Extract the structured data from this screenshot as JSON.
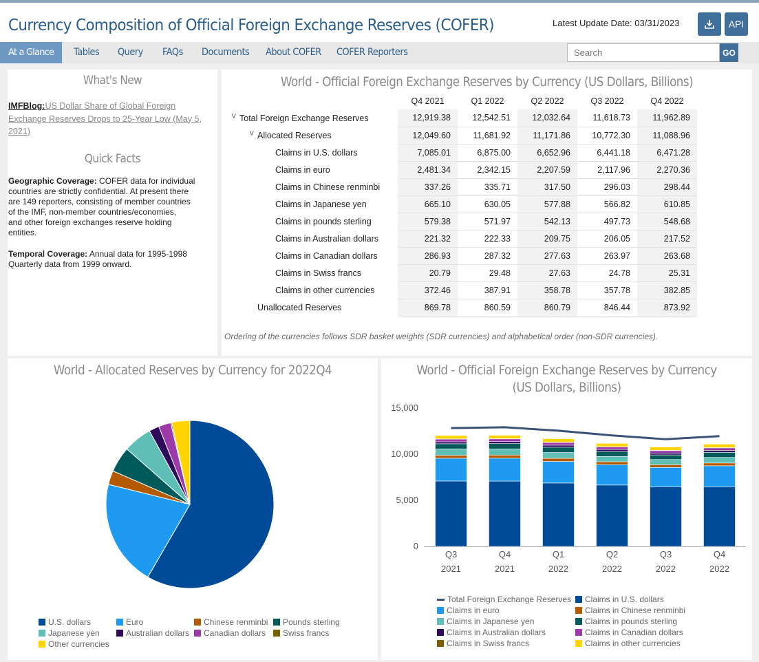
{
  "header": {
    "title": "Currency Composition of Official Foreign Exchange Reserves (COFER)",
    "update_text": "Latest Update Date: 03/31/2023",
    "download_icon": "download-icon",
    "api_label": "API"
  },
  "nav": {
    "items": [
      "At a Glance",
      "Tables",
      "Query",
      "FAQs",
      "Documents",
      "About COFER",
      "COFER Reporters"
    ],
    "search_placeholder": "Search",
    "go_label": "GO"
  },
  "sidebar": {
    "whats_new_title": "What's New",
    "blog_label": "IMFBlog:",
    "blog_lines": [
      "US Dollar Share of Global Foreign",
      "Exchange Reserves Drops to 25-Year Low (May 5,",
      "2021)"
    ],
    "quick_facts_title": "Quick Facts",
    "geo_label": "Geographic Coverage:",
    "geo_lines": [
      " COFER data for individual",
      "countries are strictly confidential. At present there",
      "are 149 reporters, consisting of member countries",
      "of the IMF, non-member countries/economies,",
      "and other foreign exchanges reserve holding",
      "entities."
    ],
    "temporal_label": "Temporal Coverage:",
    "temporal_lines": [
      " Annual data for 1995-1998",
      "Quarterly data from 1999 onward."
    ]
  },
  "table": {
    "title": "World - Official Foreign Exchange Reserves by Currency (US Dollars, Billions)",
    "columns": [
      "Q4 2021",
      "Q1 2022",
      "Q2 2022",
      "Q3 2022",
      "Q4 2022"
    ],
    "rows": [
      {
        "label": "Total Foreign Exchange Reserves",
        "values": [
          "12,919.38",
          "12,542.51",
          "12,032.64",
          "11,618.73",
          "11,962.89"
        ]
      },
      {
        "label": "Allocated Reserves",
        "values": [
          "12,049.60",
          "11,681.92",
          "11,171.86",
          "10,772.30",
          "11,088.96"
        ]
      },
      {
        "label": "Claims in U.S. dollars",
        "values": [
          "7,085.01",
          "6,875.00",
          "6,652.96",
          "6,441.18",
          "6,471.28"
        ]
      },
      {
        "label": "Claims in euro",
        "values": [
          "2,481.34",
          "2,342.15",
          "2,207.59",
          "2,117.96",
          "2,270.36"
        ]
      },
      {
        "label": "Claims in Chinese renminbi",
        "values": [
          "337.26",
          "335.71",
          "317.50",
          "296.03",
          "298.44"
        ]
      },
      {
        "label": "Claims in Japanese yen",
        "values": [
          "665.10",
          "630.05",
          "577.88",
          "566.82",
          "610.85"
        ]
      },
      {
        "label": "Claims in pounds sterling",
        "values": [
          "579.38",
          "571.97",
          "542.13",
          "497.73",
          "548.68"
        ]
      },
      {
        "label": "Claims in Australian dollars",
        "values": [
          "221.32",
          "222.33",
          "209.75",
          "206.05",
          "217.52"
        ]
      },
      {
        "label": "Claims in Canadian dollars",
        "values": [
          "286.93",
          "287.32",
          "277.63",
          "263.97",
          "263.68"
        ]
      },
      {
        "label": "Claims in Swiss francs",
        "values": [
          "20.79",
          "29.48",
          "27.63",
          "24.78",
          "25.31"
        ]
      },
      {
        "label": "Claims in other currencies",
        "values": [
          "372.46",
          "387.91",
          "358.78",
          "357.78",
          "382.85"
        ]
      },
      {
        "label": "Unallocated Reserves",
        "values": [
          "869.78",
          "860.59",
          "860.79",
          "846.44",
          "873.92"
        ]
      }
    ],
    "note": "Ordering of the currencies follows SDR basket weights (SDR currencies) and alphabetical order (non-SDR currencies)."
  },
  "colors": {
    "usd": "#004a97",
    "eur": "#1e9bf0",
    "cny": "#b35a00",
    "gbp": "#005a5a",
    "jpy": "#5fbfb6",
    "aud": "#2e0a5a",
    "cad": "#9b3aa8",
    "chf": "#7a6000",
    "other": "#ffd400",
    "total_line": "#3a5478"
  },
  "chart_data": [
    {
      "type": "pie",
      "title": "World - Allocated Reserves by Currency for 2022Q4",
      "labels": [
        "U.S. dollars",
        "Euro",
        "Chinese renminbi",
        "Pounds sterling",
        "Japanese yen",
        "Australian dollars",
        "Canadian dollars",
        "Swiss francs",
        "Other currencies"
      ],
      "values": [
        6471.28,
        2270.36,
        298.44,
        548.68,
        610.85,
        217.52,
        263.68,
        25.31,
        382.85
      ],
      "legend_position": "bottom"
    },
    {
      "type": "bar",
      "stacked": true,
      "title": "World - Official Foreign Exchange Reserves by Currency",
      "title_line2": "(US Dollars, Billions)",
      "categories": [
        "Q3 2021",
        "Q4 2021",
        "Q1 2022",
        "Q2 2022",
        "Q3 2022",
        "Q4 2022"
      ],
      "category_lines": [
        [
          "Q3",
          "2021"
        ],
        [
          "Q4",
          "2021"
        ],
        [
          "Q1",
          "2022"
        ],
        [
          "Q2",
          "2022"
        ],
        [
          "Q3",
          "2022"
        ],
        [
          "Q4",
          "2022"
        ]
      ],
      "ylim": [
        0,
        15000
      ],
      "yticks": [
        "15,000",
        "10,000",
        "5,000",
        "0"
      ],
      "ytick_values": [
        15000,
        10000,
        5000,
        0
      ],
      "line_series": {
        "name": "Total Foreign Exchange Reserves",
        "values": [
          12830,
          12919.38,
          12542.51,
          12032.64,
          11618.73,
          11962.89
        ]
      },
      "series": [
        {
          "name": "Claims in U.S. dollars",
          "key": "usd",
          "values": [
            7090,
            7085.01,
            6875.0,
            6652.96,
            6441.18,
            6471.28
          ]
        },
        {
          "name": "Claims in euro",
          "key": "eur",
          "values": [
            2470,
            2481.34,
            2342.15,
            2207.59,
            2117.96,
            2270.36
          ]
        },
        {
          "name": "Claims in Chinese renminbi",
          "key": "cny",
          "values": [
            320,
            337.26,
            335.71,
            317.5,
            296.03,
            298.44
          ]
        },
        {
          "name": "Claims in Japanese yen",
          "key": "jpy",
          "values": [
            680,
            665.1,
            630.05,
            577.88,
            566.82,
            610.85
          ]
        },
        {
          "name": "Claims in pounds sterling",
          "key": "gbp",
          "values": [
            570,
            579.38,
            571.97,
            542.13,
            497.73,
            548.68
          ]
        },
        {
          "name": "Claims in Australian dollars",
          "key": "aud",
          "values": [
            215,
            221.32,
            222.33,
            209.75,
            206.05,
            217.52
          ]
        },
        {
          "name": "Claims in Canadian dollars",
          "key": "cad",
          "values": [
            290,
            286.93,
            287.32,
            277.63,
            263.97,
            263.68
          ]
        },
        {
          "name": "Claims in Swiss francs",
          "key": "chf",
          "values": [
            20,
            20.79,
            29.48,
            27.63,
            24.78,
            25.31
          ]
        },
        {
          "name": "Claims in other currencies",
          "key": "other",
          "values": [
            370,
            372.46,
            387.91,
            358.78,
            357.78,
            382.85
          ]
        }
      ],
      "legend_position": "bottom"
    }
  ]
}
